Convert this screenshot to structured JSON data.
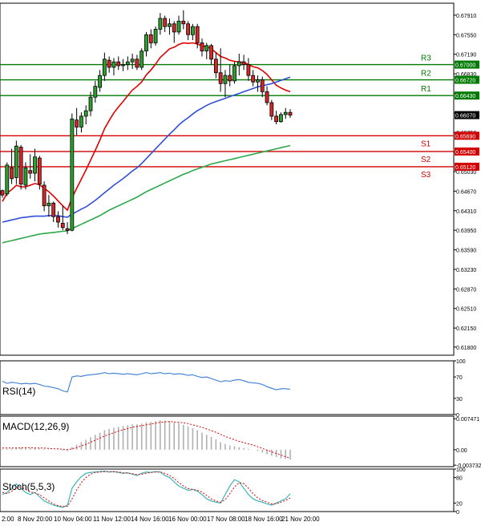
{
  "chart_data": {
    "type": "candlestick",
    "price_axis": {
      "ylim": [
        0.6165,
        0.6813
      ],
      "ticks": [
        "0.67910",
        "0.67550",
        "0.67190",
        "0.66830",
        "0.66470",
        "0.66110",
        "0.65750",
        "0.65390",
        "0.65030",
        "0.64670",
        "0.64310",
        "0.63950",
        "0.63590",
        "0.63230",
        "0.62870",
        "0.62510",
        "0.62150",
        "0.61800"
      ]
    },
    "x_ticks": [
      "2:00",
      "8 Nov 20:00",
      "10 Nov 04:00",
      "11 Nov 12:00",
      "14 Nov 16:00",
      "16 Nov 00:00",
      "17 Nov 08:00",
      "18 Nov 16:00",
      "21 Nov 20:00"
    ],
    "levels": [
      {
        "name": "R3",
        "value": 0.67,
        "label": "0.67000",
        "color": "#007a00"
      },
      {
        "name": "R2",
        "value": 0.6672,
        "label": "0.66720",
        "color": "#007a00"
      },
      {
        "name": "R1",
        "value": 0.6643,
        "label": "0.66430",
        "color": "#007a00"
      },
      {
        "name": "S1",
        "value": 0.6569,
        "label": "0.65690",
        "color": "#d40000"
      },
      {
        "name": "S2",
        "value": 0.654,
        "label": "0.65400",
        "color": "#d40000"
      },
      {
        "name": "S3",
        "value": 0.6512,
        "label": "0.65120",
        "color": "#d40000"
      }
    ],
    "current_price": {
      "value": 0.6607,
      "label": "0.66070"
    },
    "candles": [
      [
        0.6468,
        0.647,
        0.6455,
        0.646
      ],
      [
        0.6462,
        0.652,
        0.6458,
        0.6515
      ],
      [
        0.651,
        0.6545,
        0.648,
        0.649
      ],
      [
        0.6492,
        0.656,
        0.648,
        0.655
      ],
      [
        0.6548,
        0.6552,
        0.647,
        0.648
      ],
      [
        0.6478,
        0.652,
        0.647,
        0.651
      ],
      [
        0.6505,
        0.6535,
        0.649,
        0.65
      ],
      [
        0.65,
        0.6545,
        0.6485,
        0.653
      ],
      [
        0.6528,
        0.6532,
        0.647,
        0.648
      ],
      [
        0.6478,
        0.6485,
        0.643,
        0.644
      ],
      [
        0.644,
        0.646,
        0.642,
        0.6445
      ],
      [
        0.6445,
        0.6448,
        0.641,
        0.642
      ],
      [
        0.642,
        0.643,
        0.64,
        0.641
      ],
      [
        0.6408,
        0.644,
        0.6395,
        0.64
      ],
      [
        0.6398,
        0.641,
        0.6388,
        0.6395
      ],
      [
        0.6395,
        0.661,
        0.6393,
        0.66
      ],
      [
        0.6598,
        0.662,
        0.657,
        0.6585
      ],
      [
        0.6585,
        0.6612,
        0.6575,
        0.6605
      ],
      [
        0.6605,
        0.6625,
        0.659,
        0.6615
      ],
      [
        0.6615,
        0.665,
        0.6605,
        0.664
      ],
      [
        0.664,
        0.667,
        0.663,
        0.666
      ],
      [
        0.6658,
        0.669,
        0.665,
        0.668
      ],
      [
        0.668,
        0.6722,
        0.667,
        0.671
      ],
      [
        0.6708,
        0.6715,
        0.6685,
        0.6695
      ],
      [
        0.6695,
        0.6712,
        0.668,
        0.6705
      ],
      [
        0.6705,
        0.6715,
        0.669,
        0.6698
      ],
      [
        0.6698,
        0.671,
        0.6688,
        0.67
      ],
      [
        0.67,
        0.6715,
        0.669,
        0.6705
      ],
      [
        0.6705,
        0.672,
        0.6692,
        0.671
      ],
      [
        0.671,
        0.6718,
        0.669,
        0.6695
      ],
      [
        0.6695,
        0.673,
        0.669,
        0.6725
      ],
      [
        0.6725,
        0.676,
        0.6715,
        0.6755
      ],
      [
        0.6755,
        0.6765,
        0.673,
        0.674
      ],
      [
        0.674,
        0.677,
        0.6735,
        0.6765
      ],
      [
        0.6765,
        0.6795,
        0.6755,
        0.6785
      ],
      [
        0.6785,
        0.679,
        0.676,
        0.677
      ],
      [
        0.677,
        0.6785,
        0.6755,
        0.6775
      ],
      [
        0.6775,
        0.678,
        0.674,
        0.676
      ],
      [
        0.676,
        0.679,
        0.6755,
        0.678
      ],
      [
        0.678,
        0.68,
        0.6765,
        0.6775
      ],
      [
        0.6775,
        0.678,
        0.6745,
        0.6755
      ],
      [
        0.6755,
        0.6775,
        0.6745,
        0.677
      ],
      [
        0.677,
        0.6775,
        0.673,
        0.674
      ],
      [
        0.674,
        0.6748,
        0.6715,
        0.6725
      ],
      [
        0.6725,
        0.674,
        0.671,
        0.6735
      ],
      [
        0.6735,
        0.6738,
        0.67,
        0.671
      ],
      [
        0.671,
        0.6722,
        0.6675,
        0.6685
      ],
      [
        0.6685,
        0.673,
        0.665,
        0.6665
      ],
      [
        0.6665,
        0.669,
        0.664,
        0.668
      ],
      [
        0.668,
        0.67,
        0.666,
        0.667
      ],
      [
        0.667,
        0.6705,
        0.6665,
        0.6698
      ],
      [
        0.6698,
        0.672,
        0.668,
        0.6705
      ],
      [
        0.6705,
        0.6718,
        0.669,
        0.67
      ],
      [
        0.67,
        0.6712,
        0.667,
        0.668
      ],
      [
        0.668,
        0.669,
        0.666,
        0.6668
      ],
      [
        0.6668,
        0.668,
        0.665,
        0.6672
      ],
      [
        0.6672,
        0.6678,
        0.664,
        0.665
      ],
      [
        0.665,
        0.666,
        0.6625,
        0.663
      ],
      [
        0.663,
        0.6635,
        0.6598,
        0.6605
      ],
      [
        0.6605,
        0.6615,
        0.659,
        0.6595
      ],
      [
        0.6595,
        0.6612,
        0.6593,
        0.6608
      ],
      [
        0.6608,
        0.662,
        0.66,
        0.6612
      ],
      [
        0.6612,
        0.6618,
        0.6602,
        0.6607
      ]
    ],
    "ma_lines": [
      {
        "color": "#e00000",
        "values": [
          0.6448,
          0.6463,
          0.647,
          0.6478,
          0.6475,
          0.6475,
          0.6478,
          0.6481,
          0.6479,
          0.6472,
          0.6466,
          0.6458,
          0.6449,
          0.644,
          0.6432,
          0.6455,
          0.6472,
          0.6489,
          0.6506,
          0.6524,
          0.6542,
          0.6561,
          0.6582,
          0.6597,
          0.6611,
          0.6622,
          0.6632,
          0.6643,
          0.6653,
          0.666,
          0.6668,
          0.6681,
          0.669,
          0.6701,
          0.6713,
          0.6721,
          0.6729,
          0.6732,
          0.6737,
          0.674,
          0.6739,
          0.674,
          0.6738,
          0.6734,
          0.6733,
          0.6729,
          0.6722,
          0.6715,
          0.6712,
          0.6708,
          0.6706,
          0.6705,
          0.6704,
          0.67,
          0.6696,
          0.6694,
          0.6689,
          0.6682,
          0.6672,
          0.6662,
          0.6657,
          0.6653,
          0.665
        ]
      },
      {
        "color": "#2f4fd8",
        "values": [
          0.641,
          0.6412,
          0.6414,
          0.6416,
          0.6418,
          0.6419,
          0.642,
          0.6421,
          0.6421,
          0.6421,
          0.6422,
          0.6422,
          0.6422,
          0.642,
          0.6419,
          0.6425,
          0.6429,
          0.6434,
          0.6438,
          0.6444,
          0.645,
          0.6457,
          0.6464,
          0.6471,
          0.6478,
          0.6484,
          0.649,
          0.6497,
          0.6504,
          0.651,
          0.6518,
          0.6527,
          0.6536,
          0.6545,
          0.6554,
          0.6563,
          0.6572,
          0.658,
          0.6589,
          0.6596,
          0.6602,
          0.6609,
          0.6615,
          0.662,
          0.6625,
          0.6629,
          0.6632,
          0.6635,
          0.6638,
          0.6641,
          0.6644,
          0.6647,
          0.665,
          0.6653,
          0.6656,
          0.6659,
          0.6661,
          0.6663,
          0.6665,
          0.6668,
          0.6671,
          0.6674,
          0.6677
        ]
      },
      {
        "color": "#2ea84a",
        "values": [
          0.6372,
          0.6374,
          0.6376,
          0.6378,
          0.638,
          0.6382,
          0.6384,
          0.6386,
          0.6388,
          0.6389,
          0.639,
          0.6391,
          0.6392,
          0.6393,
          0.6394,
          0.6398,
          0.6402,
          0.6406,
          0.641,
          0.6414,
          0.6418,
          0.6422,
          0.6427,
          0.6432,
          0.6436,
          0.644,
          0.6444,
          0.6448,
          0.6452,
          0.6456,
          0.6461,
          0.6466,
          0.647,
          0.6474,
          0.6478,
          0.6482,
          0.6486,
          0.649,
          0.6494,
          0.6498,
          0.6501,
          0.6505,
          0.6508,
          0.6511,
          0.6514,
          0.6517,
          0.6519,
          0.6521,
          0.6523,
          0.6525,
          0.6527,
          0.6529,
          0.6531,
          0.6533,
          0.6535,
          0.6537,
          0.6539,
          0.6541,
          0.6543,
          0.6545,
          0.6547,
          0.6549,
          0.6551
        ]
      }
    ],
    "rsi": {
      "label": "RSI(14)",
      "ylim": [
        0,
        100
      ],
      "ticks": [
        "100",
        "70",
        "30",
        "0"
      ],
      "tick_values": [
        100,
        70,
        30,
        0
      ],
      "values": [
        62,
        58,
        60,
        59,
        57,
        58,
        57,
        58,
        56,
        53,
        52,
        50,
        48,
        44,
        42,
        70,
        72,
        71,
        73,
        74,
        75,
        76,
        78,
        76,
        77,
        76,
        75,
        76,
        75,
        74,
        76,
        78,
        76,
        77,
        78,
        76,
        77,
        75,
        76,
        75,
        73,
        74,
        71,
        69,
        70,
        67,
        64,
        61,
        63,
        62,
        64,
        65,
        63,
        60,
        59,
        58,
        56,
        52,
        49,
        46,
        48,
        48,
        47
      ]
    },
    "macd": {
      "label": "MACD(12,26,9)",
      "ylim": [
        -0.0041,
        0.0081
      ],
      "ticks": [
        "0.007471",
        "0.00",
        "-0.003732"
      ],
      "tick_values": [
        0.007471,
        0,
        -0.003732
      ],
      "histogram": [
        0.0002,
        0.0002,
        0.0003,
        0.0004,
        0.0005,
        0.0005,
        0.0004,
        0.0004,
        0.0003,
        0.0002,
        0.0001,
        0.0,
        -0.0001,
        -0.0002,
        -0.0003,
        0.0006,
        0.0012,
        0.0018,
        0.0024,
        0.003,
        0.0036,
        0.0041,
        0.0047,
        0.005,
        0.0053,
        0.0055,
        0.0057,
        0.0059,
        0.0061,
        0.0061,
        0.0063,
        0.0066,
        0.0067,
        0.0069,
        0.0071,
        0.007,
        0.0069,
        0.0066,
        0.0064,
        0.006,
        0.0056,
        0.0052,
        0.0047,
        0.0041,
        0.0036,
        0.0031,
        0.0025,
        0.0018,
        0.0014,
        0.001,
        0.0008,
        0.0006,
        0.0004,
        0.0002,
        0.0,
        -0.0003,
        -0.0007,
        -0.0011,
        -0.0015,
        -0.0018,
        -0.0021,
        -0.0022,
        -0.0024
      ],
      "signal": [
        0.0004,
        0.0004,
        0.0004,
        0.0004,
        0.0004,
        0.0005,
        0.0005,
        0.0004,
        0.0004,
        0.0004,
        0.0003,
        0.0002,
        0.0002,
        0.0001,
        0.0,
        0.0002,
        0.0005,
        0.0009,
        0.0013,
        0.0018,
        0.0023,
        0.0028,
        0.0033,
        0.0037,
        0.0041,
        0.0045,
        0.0048,
        0.0051,
        0.0054,
        0.0056,
        0.0058,
        0.006,
        0.0062,
        0.0064,
        0.0066,
        0.0067,
        0.0068,
        0.0067,
        0.0066,
        0.0065,
        0.0063,
        0.006,
        0.0057,
        0.0054,
        0.005,
        0.0046,
        0.0042,
        0.0037,
        0.0032,
        0.0028,
        0.0024,
        0.002,
        0.0017,
        0.0014,
        0.0011,
        0.0007,
        0.0003,
        -0.0001,
        -0.0005,
        -0.0009,
        -0.0013,
        -0.0017,
        -0.002
      ]
    },
    "stoch": {
      "label": "Stoch(5,5,3)",
      "ylim": [
        0,
        100
      ],
      "ticks": [
        "100",
        "80",
        "20",
        "0"
      ],
      "tick_values": [
        100,
        80,
        20,
        0
      ],
      "main": [
        40,
        45,
        55,
        65,
        55,
        45,
        40,
        45,
        35,
        25,
        20,
        15,
        12,
        10,
        15,
        55,
        70,
        82,
        90,
        92,
        93,
        94,
        95,
        93,
        94,
        92,
        90,
        91,
        88,
        85,
        90,
        93,
        92,
        94,
        93,
        85,
        80,
        70,
        60,
        55,
        50,
        52,
        48,
        40,
        30,
        25,
        22,
        20,
        40,
        60,
        75,
        70,
        55,
        40,
        30,
        25,
        22,
        18,
        15,
        20,
        25,
        30,
        42
      ],
      "signal": [
        45,
        42,
        48,
        55,
        58,
        52,
        46,
        44,
        40,
        32,
        25,
        18,
        14,
        12,
        12,
        30,
        50,
        68,
        80,
        88,
        92,
        93,
        94,
        94,
        94,
        93,
        91,
        91,
        89,
        87,
        88,
        90,
        92,
        93,
        93,
        90,
        85,
        78,
        68,
        60,
        54,
        52,
        50,
        46,
        38,
        30,
        25,
        22,
        28,
        42,
        58,
        68,
        66,
        55,
        42,
        32,
        26,
        22,
        18,
        18,
        22,
        26,
        32
      ]
    }
  }
}
